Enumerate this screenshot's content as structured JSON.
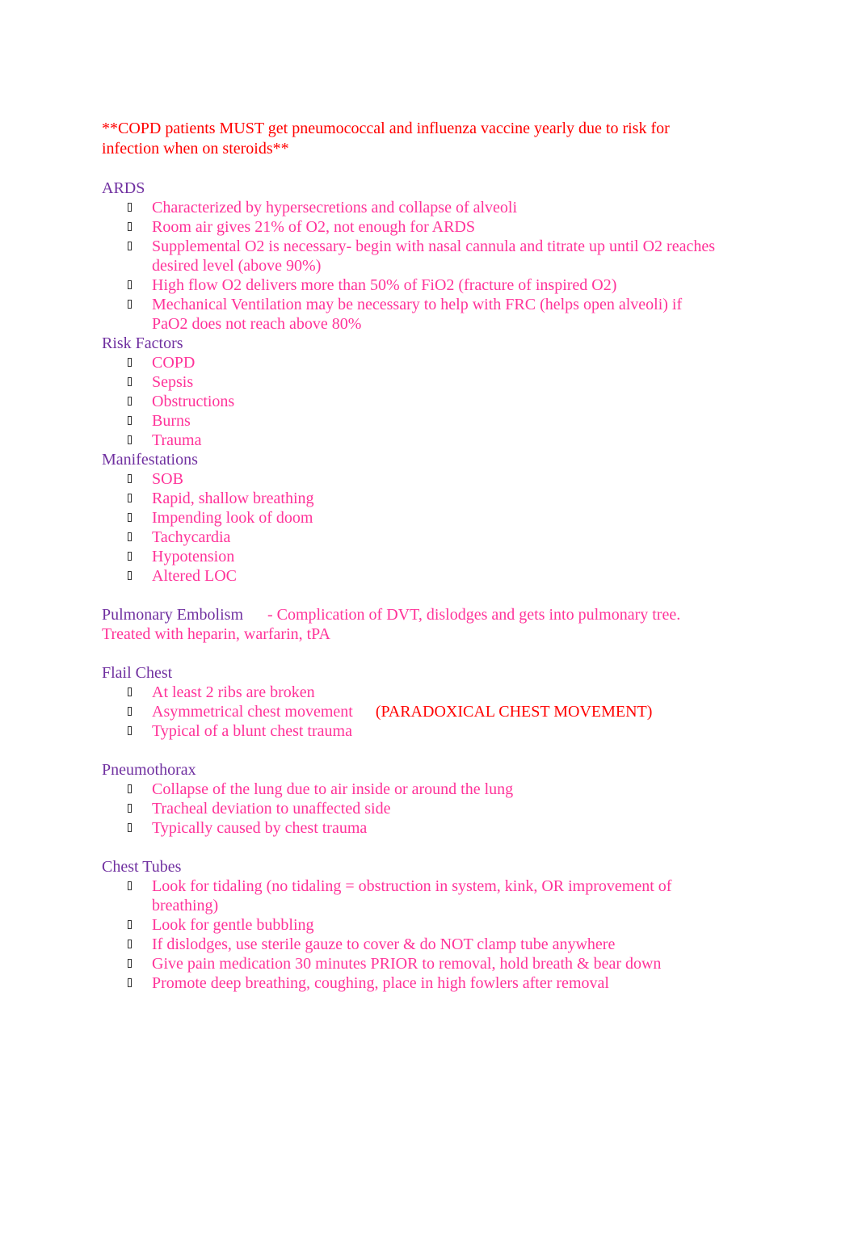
{
  "colors": {
    "heading": "#7030a0",
    "item": "#ff3399",
    "warning": "#ff0000"
  },
  "warning": "**COPD patients MUST get pneumococcal and influenza vaccine yearly due to risk for infection when on steroids**",
  "sections": {
    "ards": {
      "title": "ARDS",
      "items": [
        "Characterized by hypersecretions and collapse of alveoli",
        "Room air gives 21% of O2, not enough for ARDS",
        "Supplemental O2 is necessary- begin with nasal cannula and titrate up until O2 reaches desired level (above 90%)",
        "High flow O2 delivers more than 50% of FiO2 (fracture of inspired O2)",
        "Mechanical Ventilation may be necessary to help with FRC (helps open alveoli) if PaO2 does not reach above 80%"
      ]
    },
    "risk_factors": {
      "title": "Risk Factors",
      "items": [
        "COPD",
        "Sepsis",
        "Obstructions",
        "Burns",
        "Trauma"
      ]
    },
    "manifestations": {
      "title": "Manifestations",
      "items": [
        "SOB",
        "Rapid, shallow breathing",
        "Impending look of doom",
        "Tachycardia",
        "Hypotension",
        "Altered LOC"
      ]
    },
    "pe": {
      "title": "Pulmonary Embolism",
      "desc": "- Complication of DVT, dislodges and gets into pulmonary tree.",
      "desc2": "Treated with heparin, warfarin, tPA"
    },
    "flail": {
      "title": "Flail Chest",
      "items": [
        "At least 2 ribs are broken",
        "Asymmetrical chest movement",
        "Typical of a blunt chest trauma"
      ],
      "emphasis": "(PARADOXICAL CHEST MOVEMENT)"
    },
    "pneumo": {
      "title": "Pneumothorax",
      "items": [
        "Collapse of the lung due to air inside or around the lung",
        "Tracheal deviation to unaffected side",
        "Typically caused by chest trauma"
      ]
    },
    "tubes": {
      "title": "Chest Tubes",
      "items": [
        "Look for tidaling (no tidaling = obstruction in system, kink, OR improvement of breathing)",
        "Look for gentle bubbling",
        "If dislodges, use sterile gauze to cover & do NOT clamp tube anywhere",
        "Give pain medication 30 minutes PRIOR to removal, hold breath & bear down",
        "Promote deep breathing, coughing, place in high fowlers after removal"
      ]
    }
  }
}
